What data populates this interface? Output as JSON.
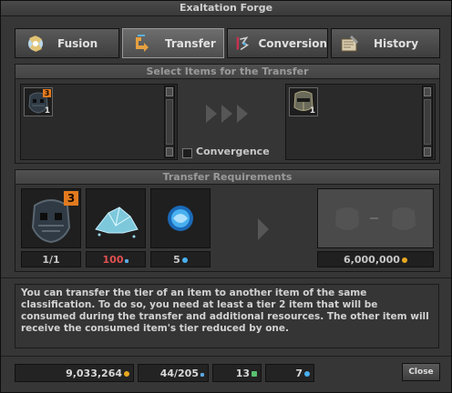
{
  "window": {
    "title": "Exaltation Forge"
  },
  "tabs": [
    {
      "label": "Fusion",
      "icon": "fusion-icon",
      "active": false
    },
    {
      "label": "Transfer",
      "icon": "transfer-icon",
      "active": true
    },
    {
      "label": "Conversion",
      "icon": "conversion-icon",
      "active": false
    },
    {
      "label": "History",
      "icon": "history-icon",
      "active": false
    }
  ],
  "select_panel": {
    "title": "Select Items for the Transfer",
    "source_item": {
      "icon": "dark-helmet-icon",
      "tier": "3",
      "count": "1"
    },
    "target_item": {
      "icon": "steel-helmet-icon",
      "count": "1"
    },
    "convergence_label": "Convergence",
    "convergence_checked": false
  },
  "requirements_panel": {
    "title": "Transfer Requirements",
    "items": [
      {
        "icon": "dark-helmet-icon",
        "tier": "3",
        "label": "1/1",
        "color": "#d8d8d8"
      },
      {
        "icon": "dust-icon",
        "label": "100",
        "color": "#e05050",
        "currency": "dust"
      },
      {
        "icon": "core-icon",
        "label": "5",
        "color": "#d8d8d8",
        "currency": "core"
      }
    ],
    "result": {
      "label": "6,000,000",
      "currency": "gold"
    }
  },
  "description": "You can transfer the tier of an item to another item of the same classification. To do so, you need at least a tier 2 item that will be consumed during the transfer and additional resources. The other item will receive the consumed item's tier reduced by one.",
  "footer": {
    "gold": "9,033,264",
    "dust": "44/205",
    "slivers": "13",
    "cores": "7",
    "close_label": "Close"
  },
  "colors": {
    "gold": "#e8a820",
    "dust": "#5aa8e0",
    "sliver": "#58c070",
    "core": "#48b0f0",
    "tier_badge": "#e27a1e"
  }
}
